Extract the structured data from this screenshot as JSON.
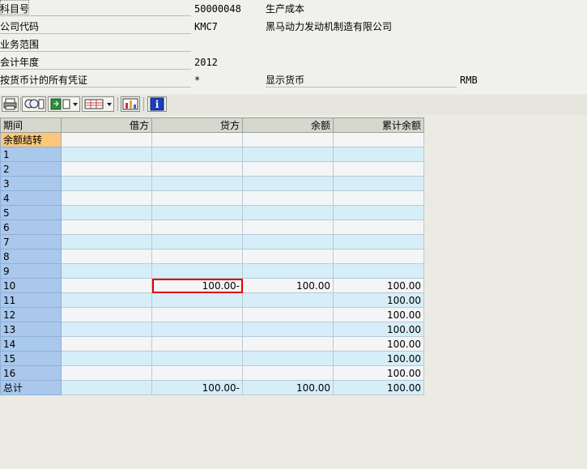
{
  "header": {
    "fields": [
      {
        "label": "科目号",
        "value": "50000048",
        "value2": "生产成本"
      },
      {
        "label": "公司代码",
        "value": "KMC7",
        "value2": "黑马动力发动机制造有限公司"
      },
      {
        "label": "业务范围",
        "value": "",
        "value2": ""
      },
      {
        "label": "会计年度",
        "value": "2012",
        "value2": ""
      },
      {
        "label": "按货币计的所有凭证",
        "value": "*",
        "value2": "显示货币",
        "value3": "RMB"
      }
    ]
  },
  "toolbar": {
    "buttons": [
      "print-icon",
      "find-icon",
      "export-icon",
      "local-file-icon",
      "layout-icon",
      "chart-icon",
      "info-icon"
    ]
  },
  "grid": {
    "columns": [
      "期间",
      "借方",
      "贷方",
      "余额",
      "累计余额"
    ],
    "rows": [
      {
        "period": "余额结转",
        "debit": "",
        "credit": "",
        "balance": "",
        "cumulative": ""
      },
      {
        "period": "1",
        "debit": "",
        "credit": "",
        "balance": "",
        "cumulative": ""
      },
      {
        "period": "2",
        "debit": "",
        "credit": "",
        "balance": "",
        "cumulative": ""
      },
      {
        "period": "3",
        "debit": "",
        "credit": "",
        "balance": "",
        "cumulative": ""
      },
      {
        "period": "4",
        "debit": "",
        "credit": "",
        "balance": "",
        "cumulative": ""
      },
      {
        "period": "5",
        "debit": "",
        "credit": "",
        "balance": "",
        "cumulative": ""
      },
      {
        "period": "6",
        "debit": "",
        "credit": "",
        "balance": "",
        "cumulative": ""
      },
      {
        "period": "7",
        "debit": "",
        "credit": "",
        "balance": "",
        "cumulative": ""
      },
      {
        "period": "8",
        "debit": "",
        "credit": "",
        "balance": "",
        "cumulative": ""
      },
      {
        "period": "9",
        "debit": "",
        "credit": "",
        "balance": "",
        "cumulative": ""
      },
      {
        "period": "10",
        "debit": "",
        "credit": "100.00-",
        "balance": "100.00",
        "cumulative": "100.00"
      },
      {
        "period": "11",
        "debit": "",
        "credit": "",
        "balance": "",
        "cumulative": "100.00"
      },
      {
        "period": "12",
        "debit": "",
        "credit": "",
        "balance": "",
        "cumulative": "100.00"
      },
      {
        "period": "13",
        "debit": "",
        "credit": "",
        "balance": "",
        "cumulative": "100.00"
      },
      {
        "period": "14",
        "debit": "",
        "credit": "",
        "balance": "",
        "cumulative": "100.00"
      },
      {
        "period": "15",
        "debit": "",
        "credit": "",
        "balance": "",
        "cumulative": "100.00"
      },
      {
        "period": "16",
        "debit": "",
        "credit": "",
        "balance": "",
        "cumulative": "100.00"
      },
      {
        "period": "总计",
        "debit": "",
        "credit": "100.00-",
        "balance": "100.00",
        "cumulative": "100.00"
      }
    ]
  },
  "colors": {
    "highlight_border": "#e00000",
    "period_cell": "#a9c8ec",
    "period_selected": "#fbc77b",
    "row_stripe": "#d5eef7"
  }
}
